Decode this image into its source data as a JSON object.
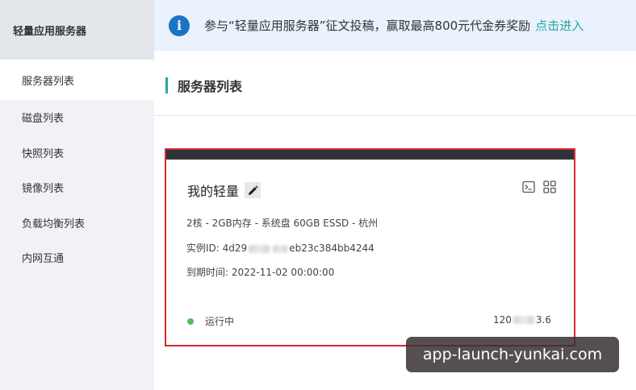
{
  "sidebar": {
    "title": "轻量应用服务器",
    "items": [
      {
        "label": "服务器列表"
      },
      {
        "label": "磁盘列表"
      },
      {
        "label": "快照列表"
      },
      {
        "label": "镜像列表"
      },
      {
        "label": "负载均衡列表"
      },
      {
        "label": "内网互通"
      }
    ]
  },
  "notice": {
    "icon": "info-icon",
    "text": "参与“轻量应用服务器”征文投稿，赢取最高800元代金券奖励",
    "link": "点击进入"
  },
  "main": {
    "title": "服务器列表"
  },
  "card": {
    "name": "我的轻量",
    "spec": "2核 - 2GB内存 - 系统盘 60GB ESSD - 杭州",
    "instance_label": "实例ID:",
    "instance_prefix": "4d29",
    "instance_suffix": "eb23c384bb4244",
    "expire_label": "到期时间:",
    "expire_value": "2022-11-02 00:00:00",
    "status": "运行中",
    "ip_prefix": "120",
    "ip_suffix": "3.6"
  },
  "watermark": "app-launch-yunkai.com",
  "colors": {
    "accent": "#2aa5a8",
    "info": "#1a73c8",
    "highlight": "#d9272e",
    "running": "#5cb85c"
  }
}
